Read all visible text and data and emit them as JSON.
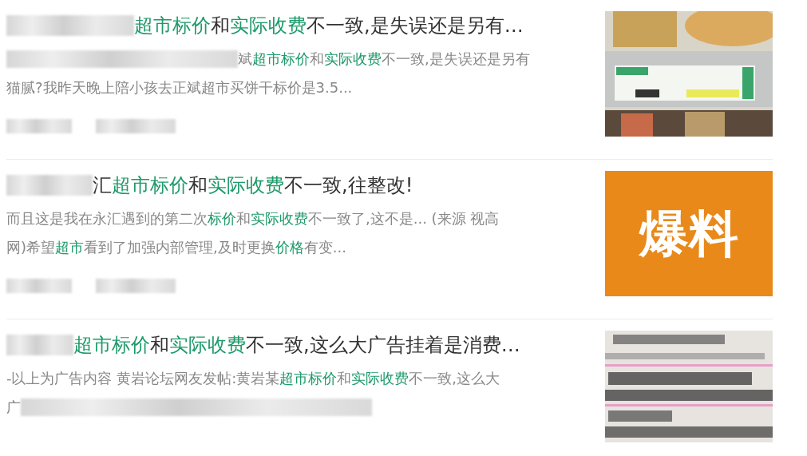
{
  "results": [
    {
      "title": {
        "blur_before": true,
        "segments": [
          {
            "text": "超市标价",
            "highlight": true
          },
          {
            "text": "和",
            "highlight": false
          },
          {
            "text": "实际收费",
            "highlight": true
          },
          {
            "text": "不一致,是失误还是另有…",
            "highlight": false
          }
        ]
      },
      "snippet": [
        {
          "blur_before": true,
          "blur_after": false,
          "segments": [
            {
              "text": "斌",
              "highlight": false
            },
            {
              "text": "超市标价",
              "highlight": true
            },
            {
              "text": "和",
              "highlight": false
            },
            {
              "text": "实际收费",
              "highlight": true
            },
            {
              "text": "不一致,是失误还是另有",
              "highlight": false
            }
          ]
        },
        {
          "blur_before": false,
          "blur_after": false,
          "segments": [
            {
              "text": "猫腻?我昨天晚上陪小孩去正斌超市买饼干标价是3.5...",
              "highlight": false
            }
          ]
        }
      ],
      "meta": [
        {
          "kind": "blur"
        },
        {
          "kind": "blur"
        }
      ],
      "thumbnail": {
        "kind": "picture"
      }
    },
    {
      "title": {
        "blur_before": true,
        "segments": [
          {
            "text": "汇",
            "highlight": false
          },
          {
            "text": "超市标价",
            "highlight": true
          },
          {
            "text": "和",
            "highlight": false
          },
          {
            "text": "实际收费",
            "highlight": true
          },
          {
            "text": "不一致,往整改!",
            "highlight": false
          }
        ]
      },
      "snippet": [
        {
          "blur_before": false,
          "blur_after": false,
          "segments": [
            {
              "text": "而且这是我在永汇遇到的第二次",
              "highlight": false
            },
            {
              "text": "标价",
              "highlight": true
            },
            {
              "text": "和",
              "highlight": false
            },
            {
              "text": "实际收费",
              "highlight": true
            },
            {
              "text": "不一致了,这不是... (来源 视高",
              "highlight": false
            }
          ]
        },
        {
          "blur_before": false,
          "blur_after": false,
          "segments": [
            {
              "text": "网)希望",
              "highlight": false
            },
            {
              "text": "超市",
              "highlight": true
            },
            {
              "text": "看到了加强内部管理,及时更换",
              "highlight": false
            },
            {
              "text": "价格",
              "highlight": true
            },
            {
              "text": "有变...",
              "highlight": false
            }
          ]
        }
      ],
      "meta": [
        {
          "kind": "blur"
        },
        {
          "kind": "blur"
        }
      ],
      "thumbnail": {
        "kind": "tile",
        "text": "爆料"
      }
    },
    {
      "title": {
        "blur_before": true,
        "segments": [
          {
            "text": "超市标价",
            "highlight": true
          },
          {
            "text": "和",
            "highlight": false
          },
          {
            "text": "实际收费",
            "highlight": true
          },
          {
            "text": "不一致,这么大广告挂着是消费…",
            "highlight": false
          }
        ]
      },
      "snippet": [
        {
          "blur_before": false,
          "blur_after": false,
          "segments": [
            {
              "text": "-以上为广告内容 黄岩论坛网友发帖:黄岩某",
              "highlight": false
            },
            {
              "text": "超市标价",
              "highlight": true
            },
            {
              "text": "和",
              "highlight": false
            },
            {
              "text": "实际收费",
              "highlight": true
            },
            {
              "text": "不一致,这么大",
              "highlight": false
            }
          ]
        },
        {
          "blur_before": false,
          "blur_after": true,
          "segments": [
            {
              "text": "广",
              "highlight": false
            }
          ]
        }
      ],
      "thumbnail": {
        "kind": "receipt-picture"
      }
    }
  ]
}
